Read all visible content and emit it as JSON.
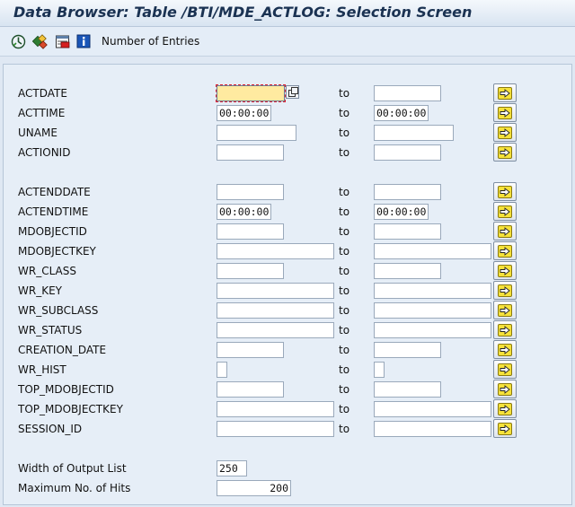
{
  "window": {
    "title": "Data Browser: Table /BTI/MDE_ACTLOG: Selection Screen"
  },
  "toolbar": {
    "icons": [
      "execute-icon",
      "selection-options-icon",
      "delete-row-icon",
      "info-icon"
    ],
    "number_of_entries_label": "Number of Entries"
  },
  "to_label": "to",
  "fields": [
    {
      "name": "ACTDATE",
      "low": "",
      "high": ""
    },
    {
      "name": "ACTTIME",
      "low": "00:00:00",
      "high": "00:00:00"
    },
    {
      "name": "UNAME",
      "low": "",
      "high": ""
    },
    {
      "name": "ACTIONID",
      "low": "",
      "high": ""
    },
    {
      "name": "ACTENDDATE",
      "low": "",
      "high": ""
    },
    {
      "name": "ACTENDTIME",
      "low": "00:00:00",
      "high": "00:00:00"
    },
    {
      "name": "MDOBJECTID",
      "low": "",
      "high": ""
    },
    {
      "name": "MDOBJECTKEY",
      "low": "",
      "high": ""
    },
    {
      "name": "WR_CLASS",
      "low": "",
      "high": ""
    },
    {
      "name": "WR_KEY",
      "low": "",
      "high": ""
    },
    {
      "name": "WR_SUBCLASS",
      "low": "",
      "high": ""
    },
    {
      "name": "WR_STATUS",
      "low": "",
      "high": ""
    },
    {
      "name": "CREATION_DATE",
      "low": "",
      "high": ""
    },
    {
      "name": "WR_HIST",
      "low": "",
      "high": ""
    },
    {
      "name": "TOP_MDOBJECTID",
      "low": "",
      "high": ""
    },
    {
      "name": "TOP_MDOBJECTKEY",
      "low": "",
      "high": ""
    },
    {
      "name": "SESSION_ID",
      "low": "",
      "high": ""
    }
  ],
  "output": {
    "width_label": "Width of Output List",
    "width_value": "250",
    "max_hits_label": "Maximum No. of Hits",
    "max_hits_value": "200"
  },
  "colors": {
    "focus_field": "#ffeaa0",
    "multi_select_arrow": "#f6e23a",
    "background": "#dfe8f3"
  }
}
